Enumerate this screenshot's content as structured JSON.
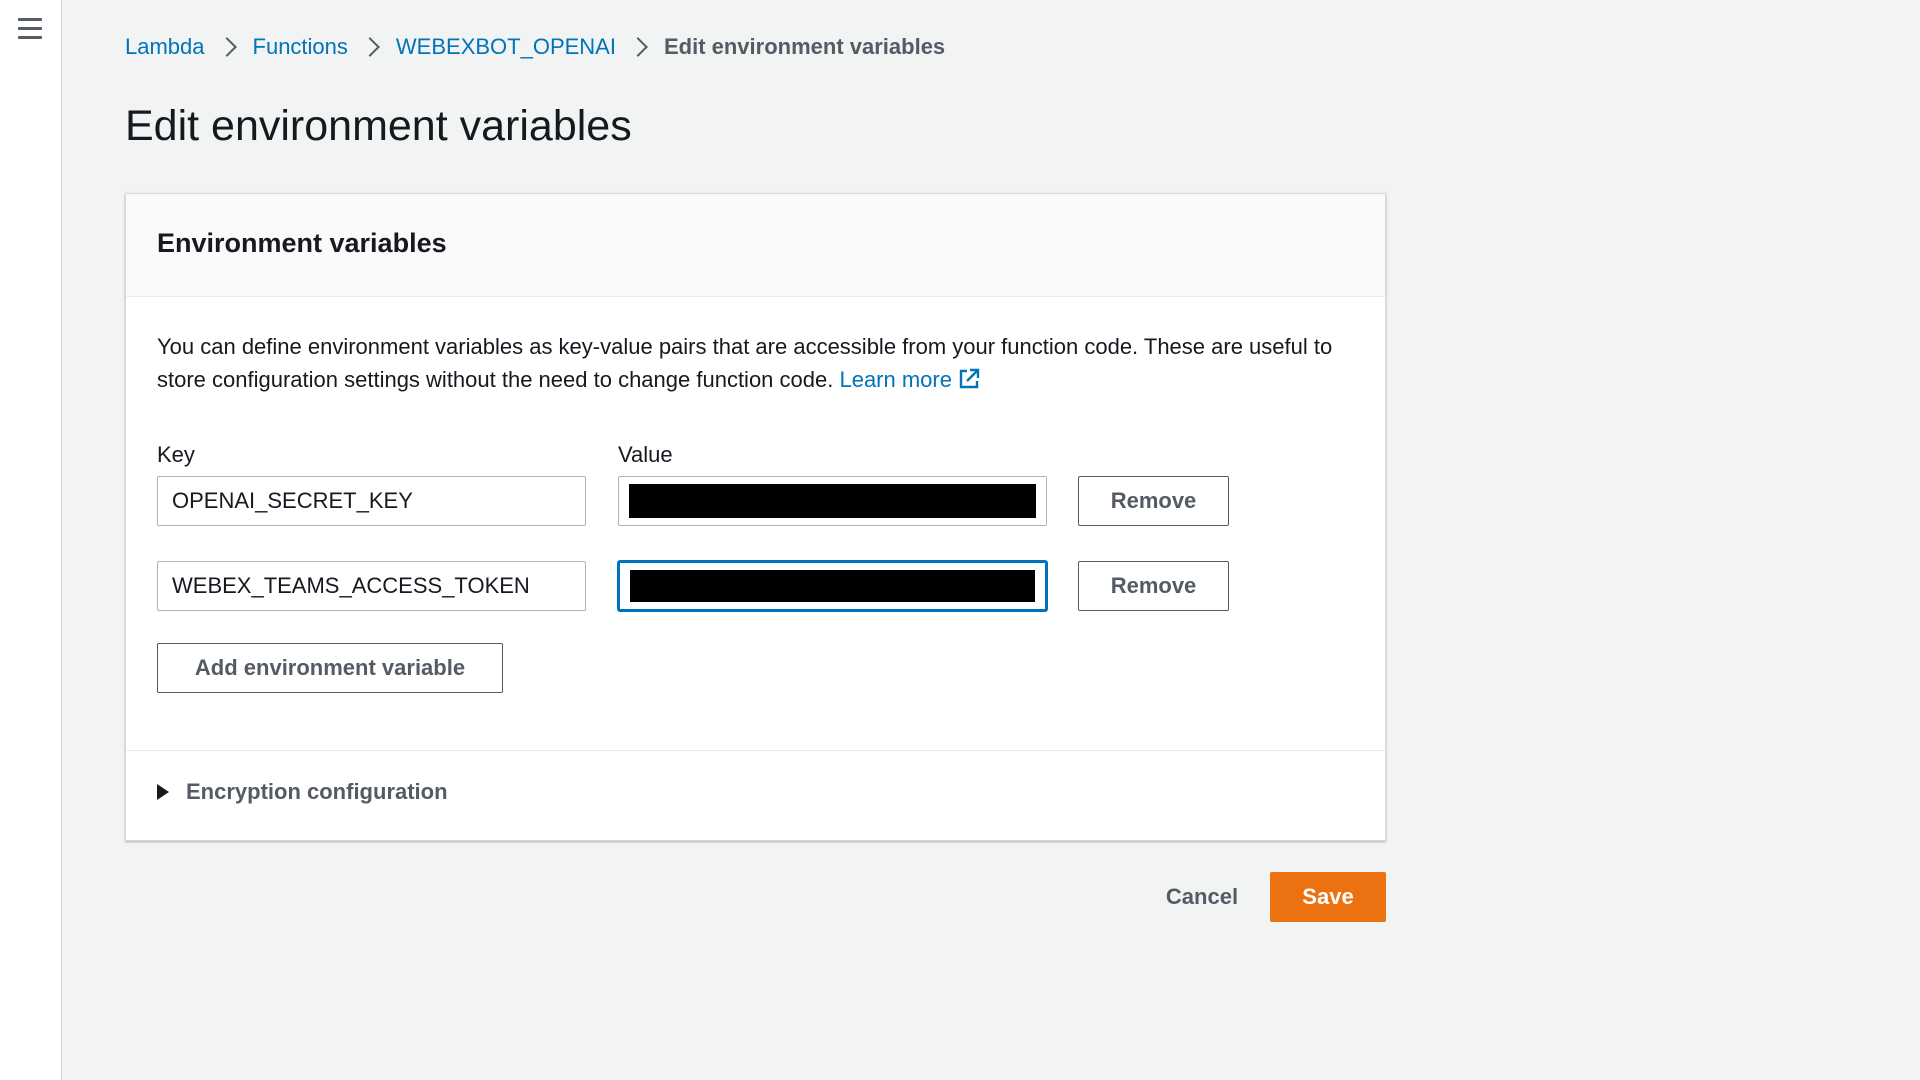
{
  "nav": {
    "menu_icon": "hamburger-menu-icon"
  },
  "breadcrumb": {
    "items": [
      "Lambda",
      "Functions",
      "WEBEXBOT_OPENAI"
    ],
    "current": "Edit environment variables",
    "separator_icon": "chevron-right-icon"
  },
  "page": {
    "title": "Edit environment variables"
  },
  "panel": {
    "title": "Environment variables",
    "description": "You can define environment variables as key-value pairs that are accessible from your function code. These are useful to store configuration settings without the need to change function code.",
    "learn_more": "Learn more",
    "learn_more_icon": "external-link-icon",
    "key_label": "Key",
    "value_label": "Value",
    "variables": [
      {
        "key": "OPENAI_SECRET_KEY",
        "value": "[redacted]",
        "remove_label": "Remove"
      },
      {
        "key": "WEBEX_TEAMS_ACCESS_TOKEN",
        "value": "[redacted]",
        "remove_label": "Remove"
      }
    ],
    "add_label": "Add environment variable",
    "encryption_label": "Encryption configuration",
    "encryption_icon": "caret-right-icon"
  },
  "actions": {
    "cancel": "Cancel",
    "save": "Save"
  },
  "colors": {
    "link": "#0073bb",
    "primary": "#ec7211",
    "background": "#f2f3f3"
  }
}
